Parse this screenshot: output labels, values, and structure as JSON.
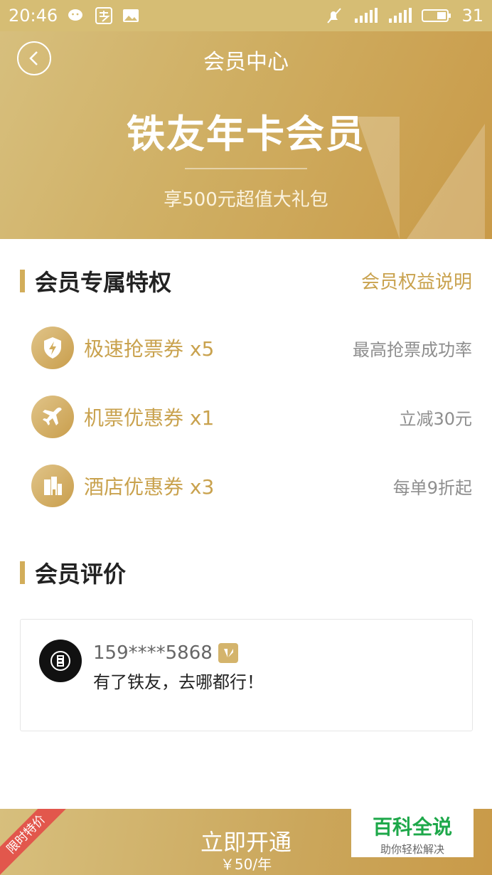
{
  "status_bar": {
    "time": "20:46",
    "battery": "31",
    "icons": [
      "wechat-icon",
      "alipay-icon",
      "image-icon",
      "mute-icon",
      "signal-icon",
      "4g-signal-icon",
      "battery-icon"
    ]
  },
  "header": {
    "nav_title": "会员中心",
    "card_title": "铁友年卡会员",
    "card_subtitle": "享500元超值大礼包"
  },
  "privileges": {
    "section_title": "会员专属特权",
    "benefits_link": "会员权益说明",
    "items": [
      {
        "name": "极速抢票券 x5",
        "desc": "最高抢票成功率",
        "icon": "lightning-shield-icon"
      },
      {
        "name": "机票优惠券 x1",
        "desc": "立减30元",
        "icon": "airplane-icon"
      },
      {
        "name": "酒店优惠券 x3",
        "desc": "每单9折起",
        "icon": "building-icon"
      }
    ]
  },
  "reviews": {
    "section_title": "会员评价",
    "items": [
      {
        "user": "159****5868",
        "text": "有了铁友，去哪都行！"
      }
    ]
  },
  "bottom": {
    "ribbon": "限时特价",
    "cta": "立即开通",
    "price": "￥50/年"
  },
  "watermark": {
    "main": "百科全说",
    "sub": "助你轻松解决"
  },
  "colors": {
    "gold": "#c9a24e",
    "gold_light": "#d7bf7d",
    "ribbon_red": "#e2574c",
    "watermark_green": "#1ea84a"
  }
}
